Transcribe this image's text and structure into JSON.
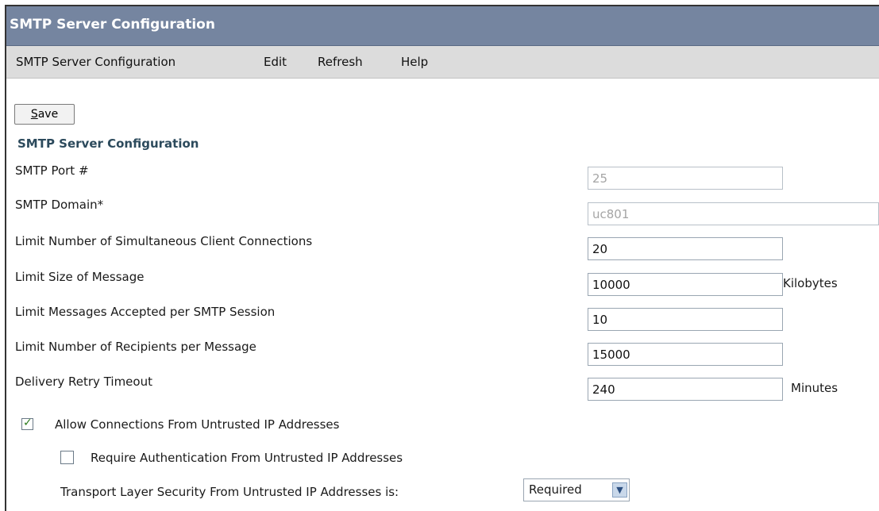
{
  "window": {
    "title": "SMTP Server Configuration"
  },
  "menu": {
    "items": [
      "SMTP Server Configuration",
      "Edit",
      "Refresh",
      "Help"
    ]
  },
  "toolbar": {
    "save_label": "ave",
    "save_accel": "S"
  },
  "section": {
    "title": "SMTP Server Configuration"
  },
  "form": {
    "smtp_port": {
      "label": "SMTP Port #",
      "value": "25"
    },
    "smtp_domain": {
      "label": "SMTP Domain*",
      "value": "uc801"
    },
    "limit_connections": {
      "label": "Limit Number of Simultaneous Client Connections",
      "value": "20"
    },
    "limit_size": {
      "label": "Limit Size of Message",
      "value": "10000",
      "unit": "Kilobytes"
    },
    "limit_messages": {
      "label": "Limit Messages Accepted per SMTP Session",
      "value": "10"
    },
    "limit_recipients": {
      "label": "Limit Number of Recipients per Message",
      "value": "15000"
    },
    "retry_timeout": {
      "label": "Delivery Retry Timeout",
      "value": "240",
      "unit": "Minutes"
    },
    "allow_untrusted": {
      "label": "Allow Connections From Untrusted IP Addresses",
      "checked": true
    },
    "require_auth": {
      "label": "Require Authentication From Untrusted IP Addresses",
      "checked": false
    },
    "tls": {
      "label": "Transport Layer Security From Untrusted IP Addresses is:",
      "value": "Required"
    }
  },
  "colors": {
    "titlebar": "#7585a0",
    "menubar": "#dcdcdc",
    "section_title": "#2c4a5c"
  }
}
